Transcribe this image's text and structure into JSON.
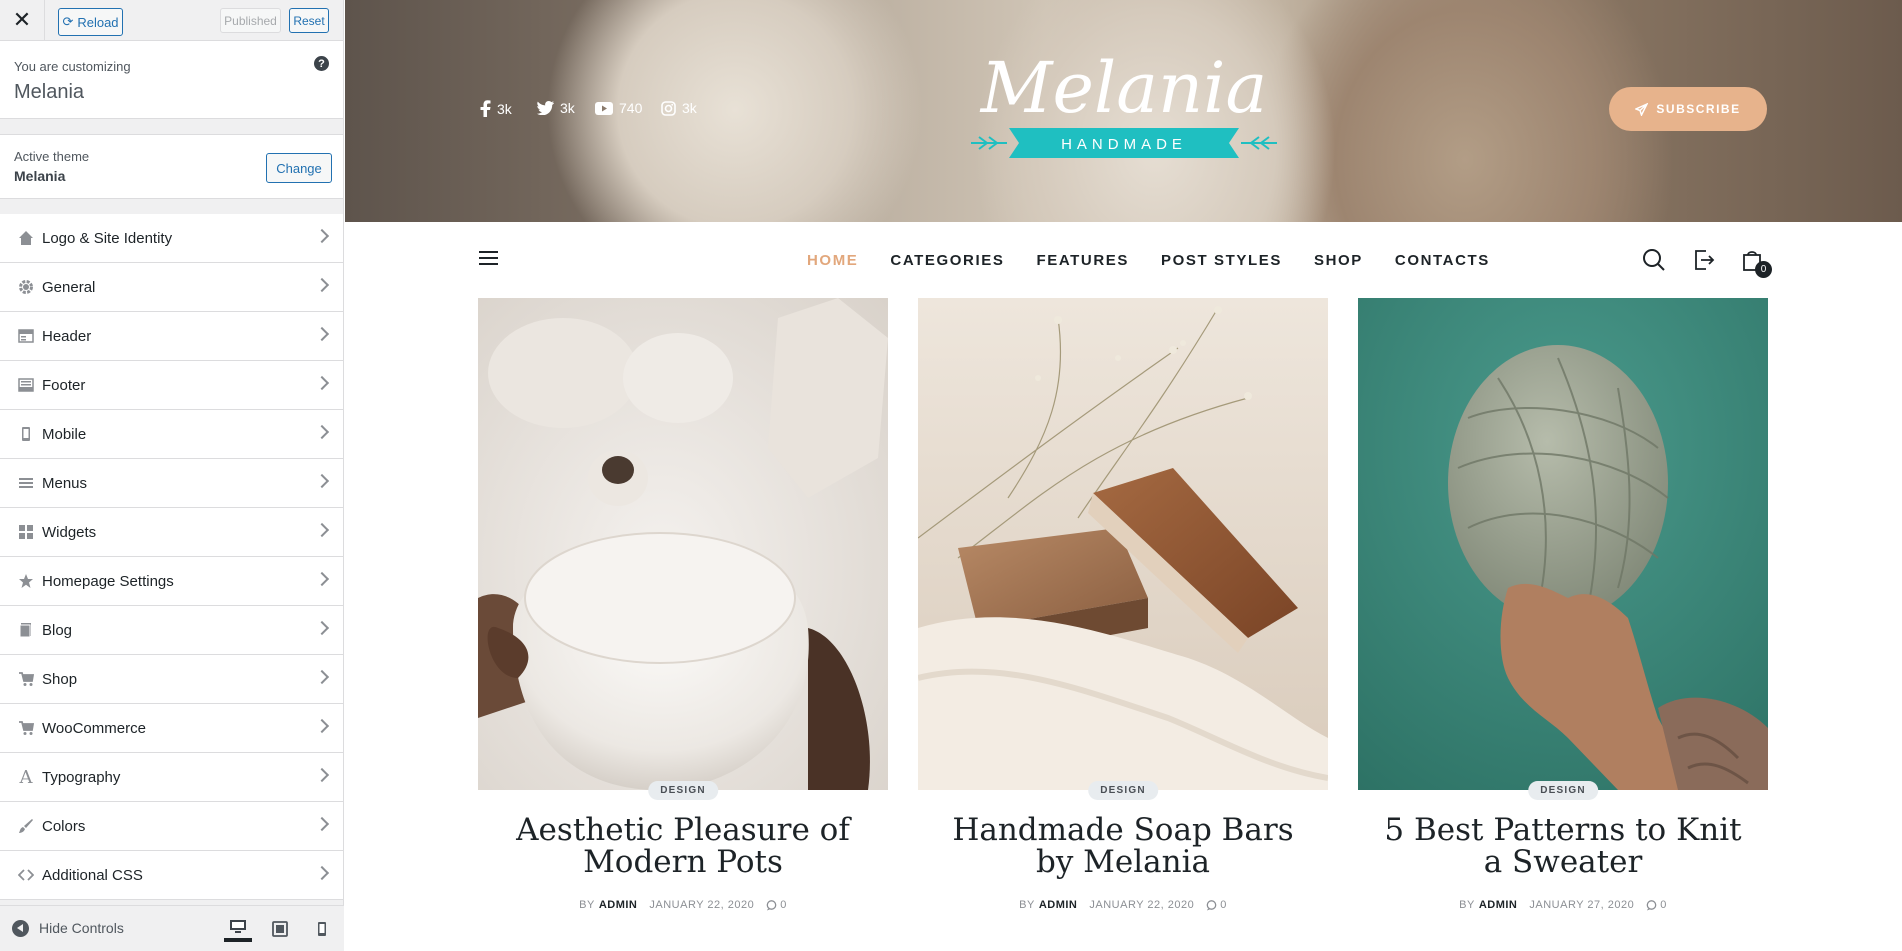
{
  "sidebar": {
    "reload_label": "Reload",
    "published_label": "Published",
    "reset_label": "Reset",
    "customizing_label": "You are customizing",
    "site_name": "Melania",
    "help_glyph": "?",
    "active_theme_label": "Active theme",
    "theme_name": "Melania",
    "change_label": "Change",
    "panels": [
      {
        "label": "Logo & Site Identity",
        "icon": "home-icon"
      },
      {
        "label": "General",
        "icon": "gear-icon"
      },
      {
        "label": "Header",
        "icon": "header-icon"
      },
      {
        "label": "Footer",
        "icon": "footer-icon"
      },
      {
        "label": "Mobile",
        "icon": "mobile-icon"
      },
      {
        "label": "Menus",
        "icon": "menu-icon"
      },
      {
        "label": "Widgets",
        "icon": "widgets-icon"
      },
      {
        "label": "Homepage Settings",
        "icon": "star-icon"
      },
      {
        "label": "Blog",
        "icon": "blog-icon"
      },
      {
        "label": "Shop",
        "icon": "cart-icon"
      },
      {
        "label": "WooCommerce",
        "icon": "cart-icon"
      },
      {
        "label": "Typography",
        "icon": "typography-icon"
      },
      {
        "label": "Colors",
        "icon": "brush-icon"
      },
      {
        "label": "Additional CSS",
        "icon": "code-icon"
      }
    ],
    "hide_controls_label": "Hide Controls"
  },
  "preview": {
    "social": [
      {
        "icon": "facebook-icon",
        "count": "3k"
      },
      {
        "icon": "twitter-icon",
        "count": "3k"
      },
      {
        "icon": "youtube-icon",
        "count": "740"
      },
      {
        "icon": "instagram-icon",
        "count": "3k"
      }
    ],
    "logo_script": "Melania",
    "logo_ribbon": "HANDMADE",
    "subscribe_label": "SUBSCRIBE",
    "menu": [
      "HOME",
      "CATEGORIES",
      "FEATURES",
      "POST STYLES",
      "SHOP",
      "CONTACTS"
    ],
    "cart_count": "0",
    "posts": [
      {
        "category": "DESIGN",
        "title": "Aesthetic Pleasure of Modern Pots",
        "by": "BY",
        "author": "ADMIN",
        "date": "JANUARY 22, 2020",
        "comments": "0"
      },
      {
        "category": "DESIGN",
        "title": "Handmade Soap Bars by Melania",
        "by": "BY",
        "author": "ADMIN",
        "date": "JANUARY 22, 2020",
        "comments": "0"
      },
      {
        "category": "DESIGN",
        "title": "5 Best Patterns to Knit a Sweater",
        "by": "BY",
        "author": "ADMIN",
        "date": "JANUARY 27, 2020",
        "comments": "0"
      }
    ]
  },
  "colors": {
    "accent": "#e2a77c",
    "wp_blue": "#2271b1",
    "ribbon": "#1fbfc1"
  }
}
